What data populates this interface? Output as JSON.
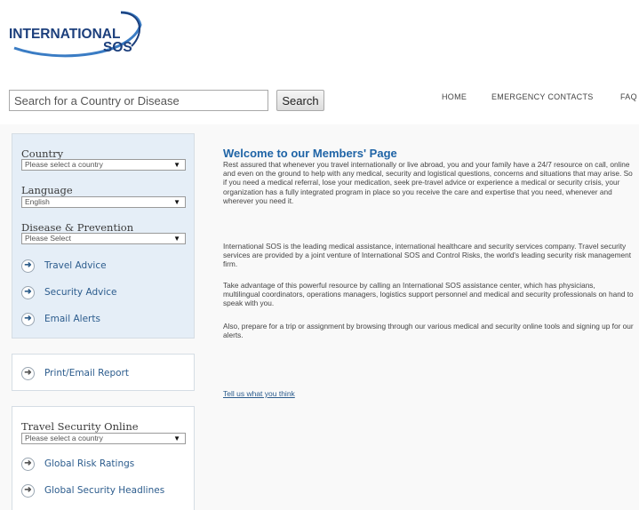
{
  "brand": {
    "line1": "INTERNATIONAL",
    "line2": "SOS",
    "colors": {
      "navy": "#1c3f7c",
      "arc": "#3a7cc4"
    }
  },
  "search": {
    "placeholder": "Search for a Country or Disease",
    "button_label": "Search"
  },
  "nav": {
    "home": "HOME",
    "emergency": "EMERGENCY CONTACTS",
    "faq": "FAQ"
  },
  "sidebar": {
    "country": {
      "label": "Country",
      "selected": "Please select a country"
    },
    "language": {
      "label": "Language",
      "selected": "English"
    },
    "disease": {
      "label": "Disease & Prevention",
      "selected": "Please Select"
    },
    "links": [
      {
        "label": "Travel Advice",
        "icon": "arrow-right-circle-icon"
      },
      {
        "label": "Security Advice",
        "icon": "arrow-right-circle-icon"
      },
      {
        "label": "Email Alerts",
        "icon": "arrow-right-circle-icon"
      }
    ],
    "print_link": "Print/Email Report",
    "tso": {
      "label": "Travel Security Online",
      "selected": "Please select a country",
      "links": [
        "Global Risk Ratings",
        "Global Security Headlines"
      ]
    }
  },
  "main": {
    "title": "Welcome to our Members' Page",
    "paragraphs": [
      "Rest assured that whenever you travel internationally or live abroad, you and your family have a 24/7 resource on call, online and even on the ground to help with any medical, security and logistical questions, concerns and situations that may arise. So if you need a medical referral, lose your medication, seek pre-travel advice or experience a medical or security crisis, your organization has a fully integrated program in place so you receive the care and expertise that you need, whenever and wherever you need it.",
      "International SOS is the leading medical assistance, international healthcare and security services company. Travel security services are provided by a joint venture of International SOS and Control Risks, the world's leading security risk management firm.",
      "Take advantage of this powerful resource by calling an International SOS assistance center, which has physicians, multilingual coordinators, operations managers, logistics support personnel and medical and security professionals on hand to speak with you.",
      "Also, prepare for a trip or assignment by browsing through our various medical and security online tools and signing up for our alerts."
    ],
    "feedback_link": "Tell us what you think"
  }
}
